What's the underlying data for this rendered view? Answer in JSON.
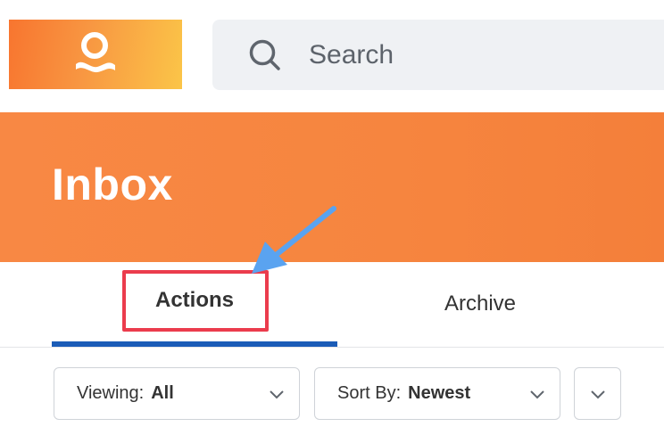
{
  "header": {
    "logo_icon": "person-logo-icon",
    "search": {
      "placeholder": "Search",
      "icon": "search-icon"
    }
  },
  "banner": {
    "title": "Inbox"
  },
  "tabs": [
    {
      "label": "Actions",
      "selected": true
    },
    {
      "label": "Archive",
      "selected": false
    }
  ],
  "filters": {
    "viewing": {
      "label": "Viewing:",
      "value": "All"
    },
    "sort": {
      "label": "Sort By:",
      "value": "Newest"
    },
    "more_icon": "chevron-down-icon"
  },
  "annotation": {
    "highlight_color": "#eb3c4d",
    "arrow_color": "#5aa3f0"
  },
  "colors": {
    "brand_orange": "#f6853f",
    "tab_underline": "#1b5cb7"
  }
}
